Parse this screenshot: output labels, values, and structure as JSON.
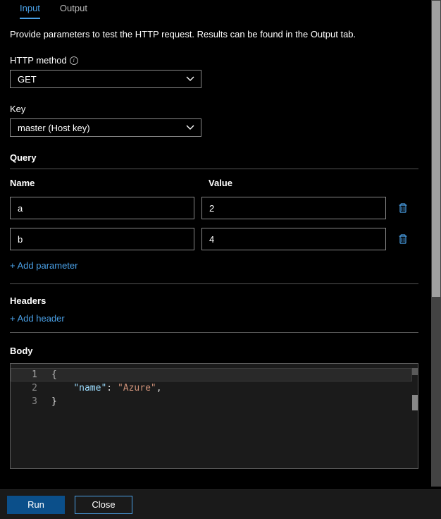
{
  "tabs": {
    "input": "Input",
    "output": "Output"
  },
  "description": "Provide parameters to test the HTTP request. Results can be found in the Output tab.",
  "httpMethod": {
    "label": "HTTP method",
    "value": "GET"
  },
  "key": {
    "label": "Key",
    "value": "master (Host key)"
  },
  "query": {
    "label": "Query",
    "nameHeader": "Name",
    "valueHeader": "Value",
    "rows": [
      {
        "name": "a",
        "value": "2"
      },
      {
        "name": "b",
        "value": "4"
      }
    ],
    "addLabel": "+ Add parameter"
  },
  "headersSection": {
    "label": "Headers",
    "addLabel": "+ Add header"
  },
  "body": {
    "label": "Body",
    "lines": {
      "1": "{",
      "2_indent": "    ",
      "2_key": "\"name\"",
      "2_colon": ": ",
      "2_value": "\"Azure\"",
      "2_comma": ",",
      "3": "}"
    },
    "lineNumbers": [
      "1",
      "2",
      "3"
    ]
  },
  "footer": {
    "run": "Run",
    "close": "Close"
  }
}
